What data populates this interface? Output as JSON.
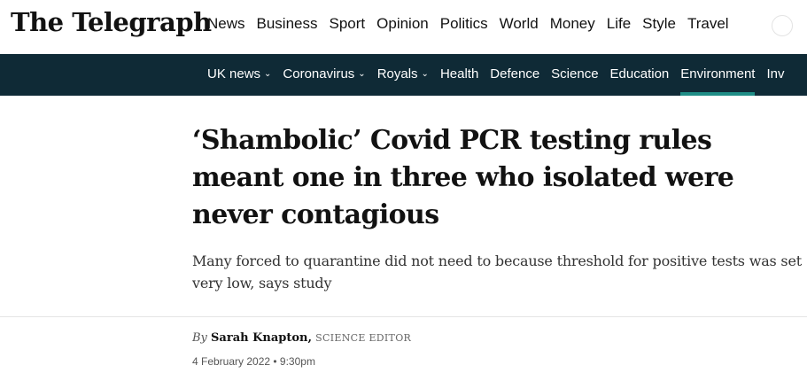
{
  "header": {
    "logo": "The Telegraph",
    "nav": [
      "News",
      "Business",
      "Sport",
      "Opinion",
      "Politics",
      "World",
      "Money",
      "Life",
      "Style",
      "Travel"
    ]
  },
  "subnav": {
    "items": [
      {
        "label": "UK news",
        "dropdown": true
      },
      {
        "label": "Coronavirus",
        "dropdown": true
      },
      {
        "label": "Royals",
        "dropdown": true
      },
      {
        "label": "Health",
        "dropdown": false
      },
      {
        "label": "Defence",
        "dropdown": false
      },
      {
        "label": "Science",
        "dropdown": false
      },
      {
        "label": "Education",
        "dropdown": false
      },
      {
        "label": "Environment",
        "dropdown": false,
        "active": true
      },
      {
        "label": "Inv",
        "dropdown": false
      }
    ],
    "background": "#0f2a36",
    "accent": "#1f8d86"
  },
  "article": {
    "headline": "‘Shambolic’ Covid PCR testing rules meant one in three who isolated were never contagious",
    "standfirst": "Many forced to quarantine did not need to because threshold for positive tests was set very low, says study",
    "byline_prefix": "By",
    "author": "Sarah Knapton,",
    "role": "SCIENCE EDITOR",
    "date": "4 February 2022 • 9:30pm"
  }
}
